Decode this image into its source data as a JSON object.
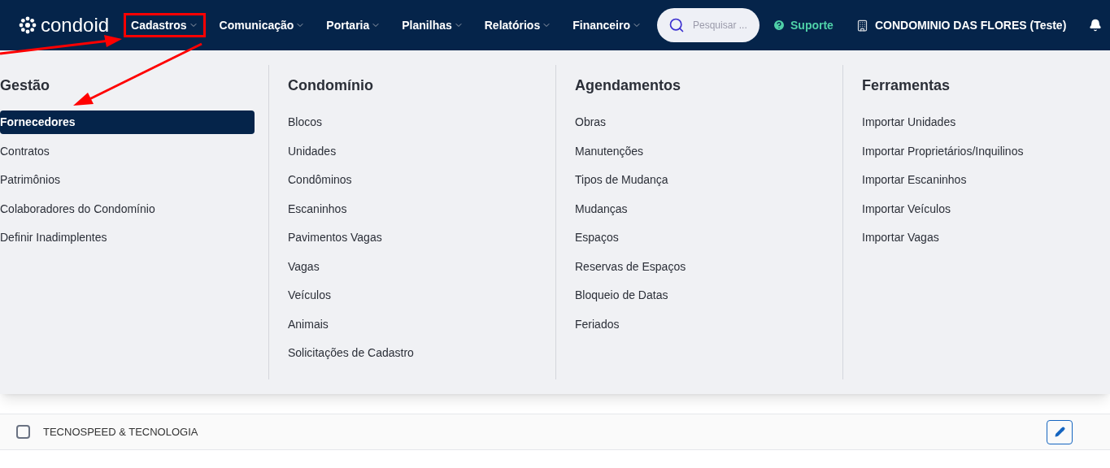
{
  "header": {
    "logo": "condoid",
    "nav": [
      {
        "label": "Cadastros",
        "highlighted": true
      },
      {
        "label": "Comunicação",
        "highlighted": false
      },
      {
        "label": "Portaria",
        "highlighted": false
      },
      {
        "label": "Planilhas",
        "highlighted": false
      },
      {
        "label": "Relatórios",
        "highlighted": false
      },
      {
        "label": "Financeiro",
        "highlighted": false
      }
    ],
    "search": {
      "placeholder": "Pesquisar ..."
    },
    "support": "Suporte",
    "condominium": "CONDOMINIO DAS FLORES (Teste)"
  },
  "menu": {
    "columns": [
      {
        "title": "Gestão",
        "items": [
          {
            "label": "Fornecedores",
            "selected": true
          },
          {
            "label": "Contratos",
            "selected": false
          },
          {
            "label": "Patrimônios",
            "selected": false
          },
          {
            "label": "Colaboradores do Condomínio",
            "selected": false
          },
          {
            "label": "Definir Inadimplentes",
            "selected": false
          }
        ]
      },
      {
        "title": "Condomínio",
        "items": [
          {
            "label": "Blocos",
            "selected": false
          },
          {
            "label": "Unidades",
            "selected": false
          },
          {
            "label": "Condôminos",
            "selected": false
          },
          {
            "label": "Escaninhos",
            "selected": false
          },
          {
            "label": "Pavimentos Vagas",
            "selected": false
          },
          {
            "label": "Vagas",
            "selected": false
          },
          {
            "label": "Veículos",
            "selected": false
          },
          {
            "label": "Animais",
            "selected": false
          },
          {
            "label": "Solicitações de Cadastro",
            "selected": false
          }
        ]
      },
      {
        "title": "Agendamentos",
        "items": [
          {
            "label": "Obras",
            "selected": false
          },
          {
            "label": "Manutenções",
            "selected": false
          },
          {
            "label": "Tipos de Mudança",
            "selected": false
          },
          {
            "label": "Mudanças",
            "selected": false
          },
          {
            "label": "Espaços",
            "selected": false
          },
          {
            "label": "Reservas de Espaços",
            "selected": false
          },
          {
            "label": "Bloqueio de Datas",
            "selected": false
          },
          {
            "label": "Feriados",
            "selected": false
          }
        ]
      },
      {
        "title": "Ferramentas",
        "items": [
          {
            "label": "Importar Unidades",
            "selected": false
          },
          {
            "label": "Importar Proprietários/Inquilinos",
            "selected": false
          },
          {
            "label": "Importar Escaninhos",
            "selected": false
          },
          {
            "label": "Importar Veículos",
            "selected": false
          },
          {
            "label": "Importar Vagas",
            "selected": false
          }
        ]
      }
    ]
  },
  "rows": [
    {
      "name": "TECNOSPEED & TECNOLOGIA",
      "checked": false
    }
  ]
}
